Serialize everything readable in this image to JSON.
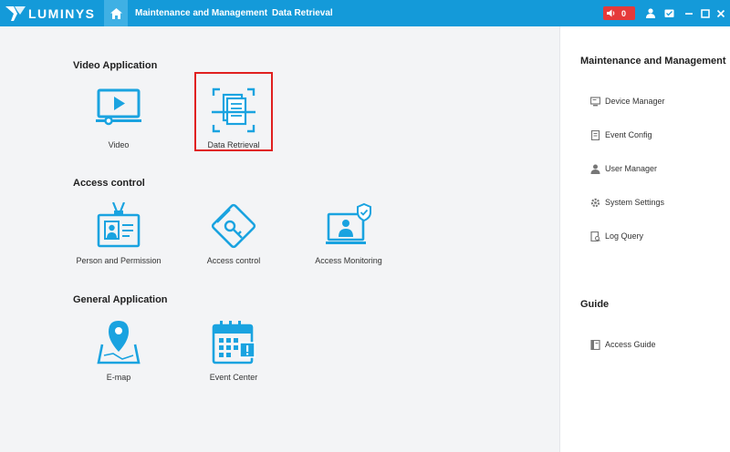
{
  "topbar": {
    "brand": "LUMINYS",
    "tabs": [
      "Maintenance and Management",
      "Data Retrieval"
    ],
    "alarm_count": "0"
  },
  "main": {
    "sections": [
      {
        "title": "Video Application",
        "apps": [
          {
            "label": "Video",
            "icon": "video-player-icon"
          },
          {
            "label": "Data Retrieval",
            "icon": "document-scan-icon"
          }
        ]
      },
      {
        "title": "Access control",
        "apps": [
          {
            "label": "Person and Permission",
            "icon": "id-badge-icon"
          },
          {
            "label": "Access control",
            "icon": "access-card-icon"
          },
          {
            "label": "Access Monitoring",
            "icon": "monitor-person-shield-icon"
          }
        ]
      },
      {
        "title": "General Application",
        "apps": [
          {
            "label": "E-map",
            "icon": "map-pin-icon"
          },
          {
            "label": "Event Center",
            "icon": "calendar-alert-icon"
          }
        ]
      }
    ]
  },
  "sidepanel": {
    "maintenance_title": "Maintenance and Management",
    "maintenance_items": [
      {
        "label": "Device Manager",
        "icon": "device-icon"
      },
      {
        "label": "Event Config",
        "icon": "event-config-icon"
      },
      {
        "label": "User Manager",
        "icon": "user-icon"
      },
      {
        "label": "System Settings",
        "icon": "gear-icon"
      },
      {
        "label": "Log Query",
        "icon": "log-query-icon"
      }
    ],
    "guide_title": "Guide",
    "guide_items": [
      {
        "label": "Access Guide",
        "icon": "guide-icon"
      }
    ]
  },
  "colors": {
    "topbar": "#149ad9",
    "accent": "#1aa3e0",
    "alarm": "#e53a3a",
    "selection": "#e02020"
  }
}
